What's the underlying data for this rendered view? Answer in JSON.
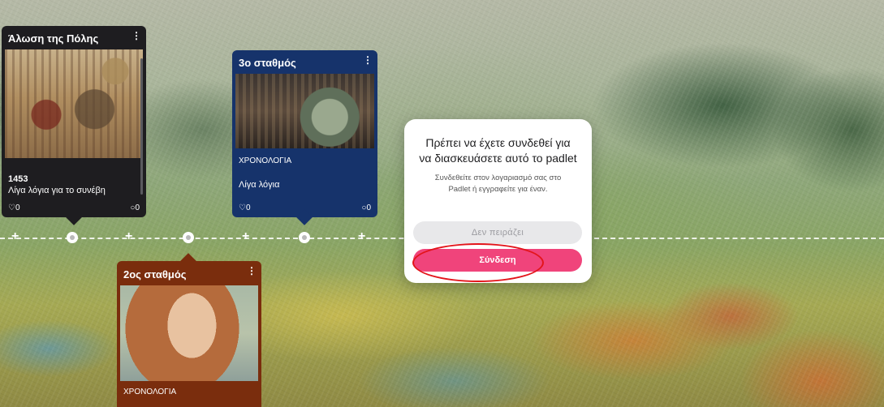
{
  "timeline": {
    "nodes": 3
  },
  "cards": [
    {
      "title": "Άλωση της Πόλης",
      "year": "1453",
      "subtitle": "Λίγα λόγια για το συνέβη",
      "likes": "0",
      "comments": "0",
      "color": "#1e1d20"
    },
    {
      "title": "3ο σταθμός",
      "label": "ΧΡΟΝΟΛΟΓΙΑ",
      "subtitle": "Λίγα λόγια",
      "likes": "0",
      "comments": "0",
      "color": "#16336b"
    },
    {
      "title": "2ος σταθμός",
      "label": "ΧΡΟΝΟΛΟΓΙΑ",
      "color": "#7a2d0d"
    }
  ],
  "modal": {
    "title": "Πρέπει να έχετε συνδεθεί για να διασκευάσετε αυτό το padlet",
    "message": "Συνδεθείτε στον λογαριασμό σας στο Padlet ή εγγραφείτε για έναν.",
    "dismiss_label": "Δεν πειράζει",
    "login_label": "Σύνδεση",
    "accent": "#f0447b",
    "highlight_color": "#e3141a"
  }
}
